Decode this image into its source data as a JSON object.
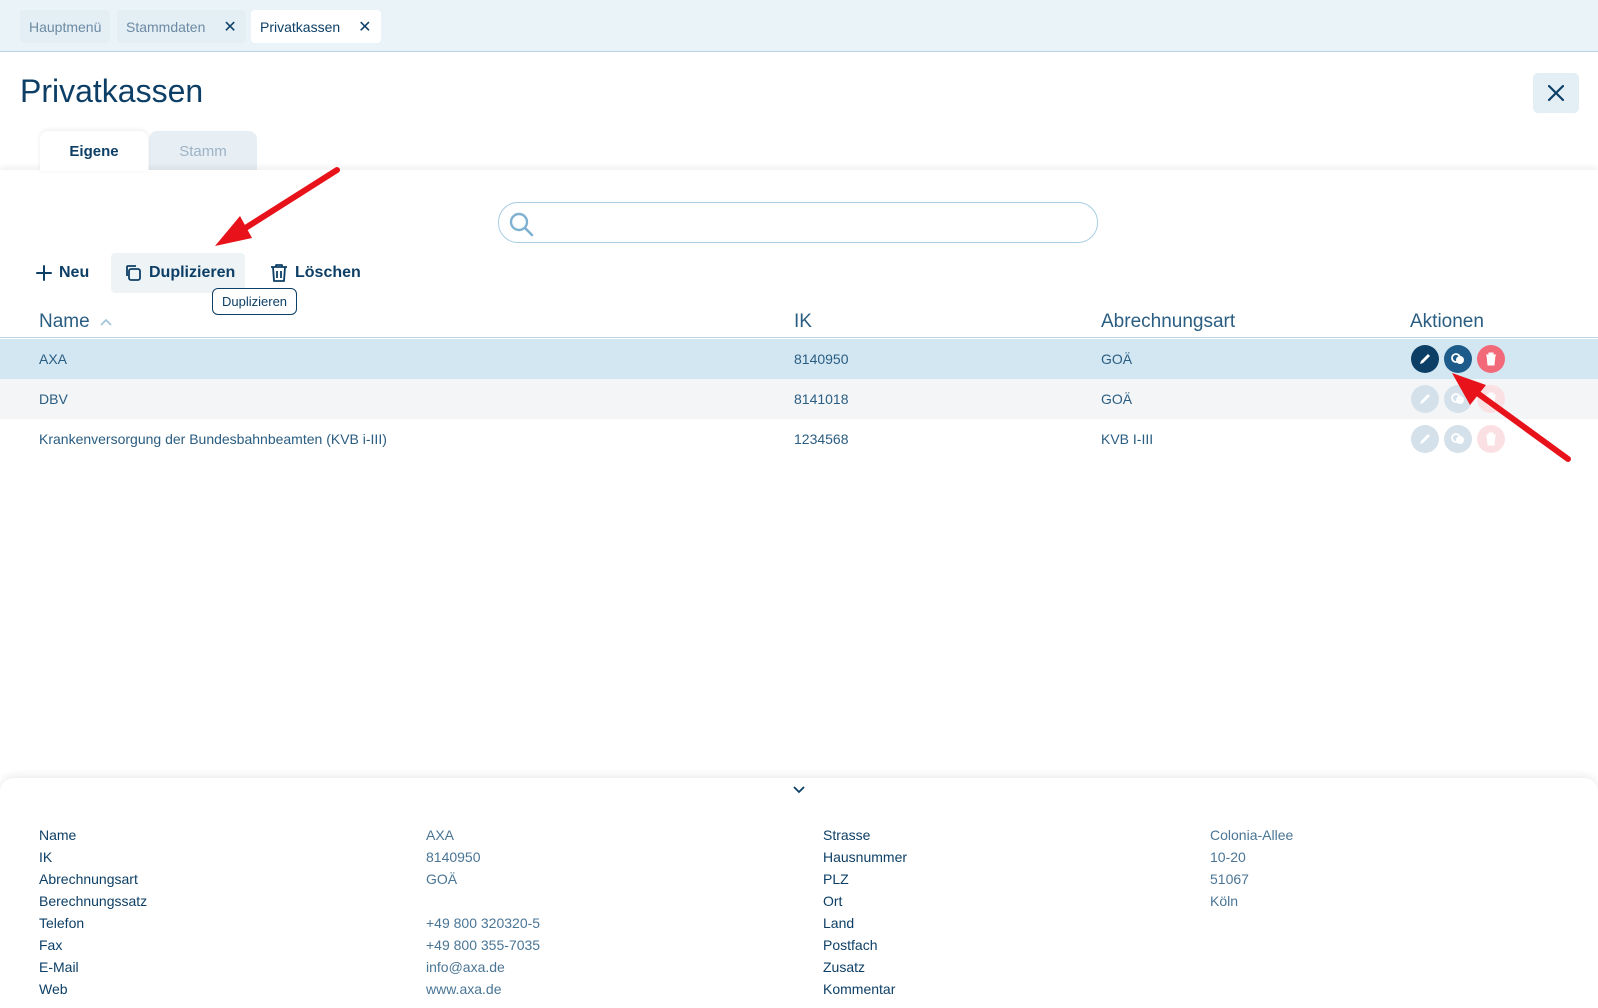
{
  "topbar": {
    "tabs": [
      {
        "label": "Hauptmenü"
      },
      {
        "label": "Stammdaten"
      },
      {
        "label": "Privatkassen"
      }
    ]
  },
  "page": {
    "title": "Privatkassen",
    "tabs": [
      {
        "label": "Eigene"
      },
      {
        "label": "Stamm"
      }
    ]
  },
  "search": {
    "placeholder": "",
    "value": ""
  },
  "toolbar": {
    "new_label": "Neu",
    "duplicate_label": "Duplizieren",
    "delete_label": "Löschen",
    "tooltip": "Duplizieren"
  },
  "table": {
    "headers": [
      "Name",
      "IK",
      "Abrechnungsart",
      "Aktionen"
    ],
    "rows": [
      {
        "name": "AXA",
        "ik": "8140950",
        "abrechnungsart": "GOÄ"
      },
      {
        "name": "DBV",
        "ik": "8141018",
        "abrechnungsart": "GOÄ"
      },
      {
        "name": "Krankenversorgung der Bundesbahnbeamten (KVB i-III)",
        "ik": "1234568",
        "abrechnungsart": "KVB I-III"
      }
    ]
  },
  "detail": {
    "left": [
      {
        "label": "Name",
        "value": "AXA"
      },
      {
        "label": "IK",
        "value": "8140950"
      },
      {
        "label": "Abrechnungsart",
        "value": "GOÄ"
      },
      {
        "label": "Berechnungssatz",
        "value": ""
      },
      {
        "label": "Telefon",
        "value": "+49 800 320320-5"
      },
      {
        "label": "Fax",
        "value": "+49 800 355-7035"
      },
      {
        "label": "E-Mail",
        "value": "info@axa.de"
      },
      {
        "label": "Web",
        "value": "www.axa.de"
      }
    ],
    "right": [
      {
        "label": "Strasse",
        "value": "Colonia-Allee"
      },
      {
        "label": "Hausnummer",
        "value": "10-20"
      },
      {
        "label": "PLZ",
        "value": "51067"
      },
      {
        "label": "Ort",
        "value": "Köln"
      },
      {
        "label": "Land",
        "value": ""
      },
      {
        "label": "Postfach",
        "value": ""
      },
      {
        "label": "Zusatz",
        "value": ""
      },
      {
        "label": "Kommentar",
        "value": ""
      }
    ]
  },
  "colors": {
    "primary": "#0d3f66",
    "selected_row": "#d2e7f2",
    "delete": "#f26a7a",
    "annotation": "#e8121a"
  },
  "icons": [
    "close-icon",
    "search-icon",
    "plus-icon",
    "copy-icon",
    "trash-icon",
    "pencil-icon",
    "duplicate-icon",
    "sort-asc-icon",
    "chevron-down-icon"
  ]
}
